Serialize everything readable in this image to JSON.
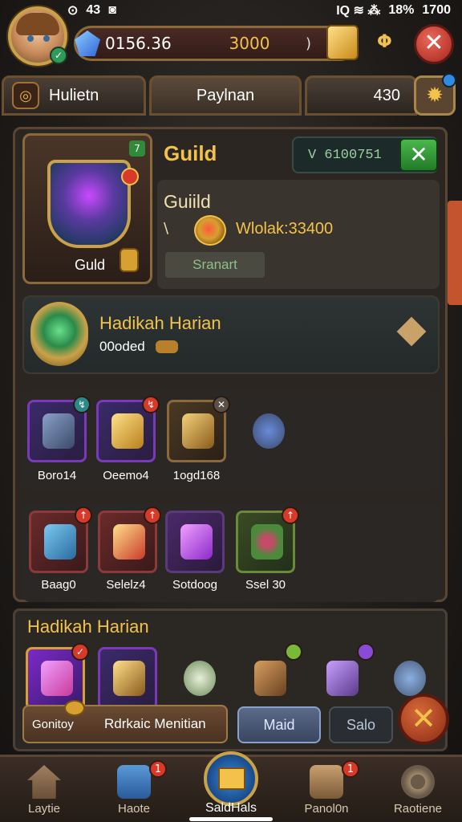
{
  "status": {
    "left_a": "⊙",
    "left_b": "43",
    "left_c": "◙",
    "signal": "IQ ≋ ⁂",
    "battery": "18%",
    "time": "1700"
  },
  "resources": {
    "gems": "0156.36",
    "gold": "3000",
    "paren": ")"
  },
  "tabs": [
    {
      "label": "Hulietn"
    },
    {
      "label": "Paylnan"
    },
    {
      "label": "430"
    }
  ],
  "guild": {
    "card_label": "Guld",
    "card_badge": "7",
    "title": "Guild",
    "code": "V 6100751",
    "subtitle": "Guiild",
    "slash": "\\",
    "wealth": "Wlolak:33400",
    "start_label": "Sranart"
  },
  "daily": {
    "title": "Hadikah Harian",
    "sub": "00oded"
  },
  "items_row1": [
    {
      "label": "Boro14",
      "badge": "↯",
      "color": "teal"
    },
    {
      "label": "Oeemo4",
      "badge": "↯",
      "color": "red"
    },
    {
      "label": "1ogd168",
      "badge": "✕",
      "color": "grey"
    },
    {
      "label": "",
      "badge": "",
      "color": ""
    }
  ],
  "items_row2": [
    {
      "label": "Baag0",
      "badge": "↑"
    },
    {
      "label": "Selelz4",
      "badge": "↑"
    },
    {
      "label": "Sotdoog",
      "badge": ""
    },
    {
      "label": "Ssel 30",
      "badge": "↑"
    }
  ],
  "bottom": {
    "title": "Hadikah Harian",
    "action_left": "Gonitoy",
    "action_right": "Rdrkaic Menitian",
    "mail": "Maid",
    "sale": "Salo",
    "close": "✕"
  },
  "nav": [
    {
      "label": "Laytie",
      "badge": ""
    },
    {
      "label": "Haote",
      "badge": "1"
    },
    {
      "label": "SaldHals",
      "badge": ""
    },
    {
      "label": "Panol0n",
      "badge": "1"
    },
    {
      "label": "Raotiene",
      "badge": ""
    }
  ],
  "colors": {
    "accent_gold": "#f3c24a",
    "panel": "#2b2622",
    "close_red": "#a8241c"
  }
}
